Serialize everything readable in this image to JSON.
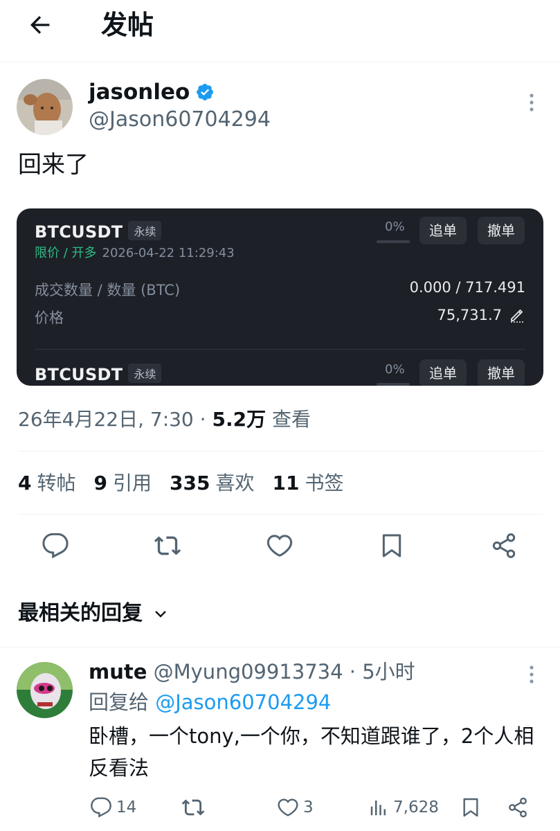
{
  "header": {
    "title": "发帖",
    "back_icon": "arrow-left-icon"
  },
  "post": {
    "author": {
      "name": "jasonleo",
      "handle": "@Jason60704294",
      "verified": true
    },
    "text": "回来了",
    "timestamp": "26年4月22日, 7:30",
    "separator": " · ",
    "views_value": "5.2万",
    "views_label": " 查看",
    "stats": [
      {
        "value": "4",
        "label": "转帖"
      },
      {
        "value": "9",
        "label": "引用"
      },
      {
        "value": "335",
        "label": "喜欢"
      },
      {
        "value": "11",
        "label": "书签"
      }
    ]
  },
  "order_card": {
    "orders": [
      {
        "symbol": "BTCUSDT",
        "contract": "永续",
        "fill_percent": "0%",
        "chase_label": "追单",
        "cancel_label": "撤单",
        "order_type": "限价 / 开多",
        "time": "2026-04-22 11:29:43",
        "qty_label": "成交数量 / 数量 (BTC)",
        "qty_value": "0.000 / 717.491",
        "price_label": "价格",
        "price_value": "75,731.7"
      },
      {
        "symbol": "BTCUSDT",
        "contract": "永续",
        "fill_percent": "0%",
        "chase_label": "追单",
        "cancel_label": "撤单"
      }
    ]
  },
  "replies_section": {
    "sort_label": "最相关的回复"
  },
  "reply": {
    "name": "mute",
    "meta": " @Myung09913734 · 5小时",
    "reply_to_prefix": "回复给 ",
    "reply_to_handle": "@Jason60704294",
    "text": "卧槽，一个tony,一个你，不知道跟谁了，2个人相反看法",
    "comments": "14",
    "likes": "3",
    "views": "7,628"
  },
  "colors": {
    "accent": "#1d9bf0",
    "text_primary": "#0f1419",
    "text_secondary": "#536471",
    "card_bg": "#1d2027",
    "order_green": "#2ebd85"
  }
}
